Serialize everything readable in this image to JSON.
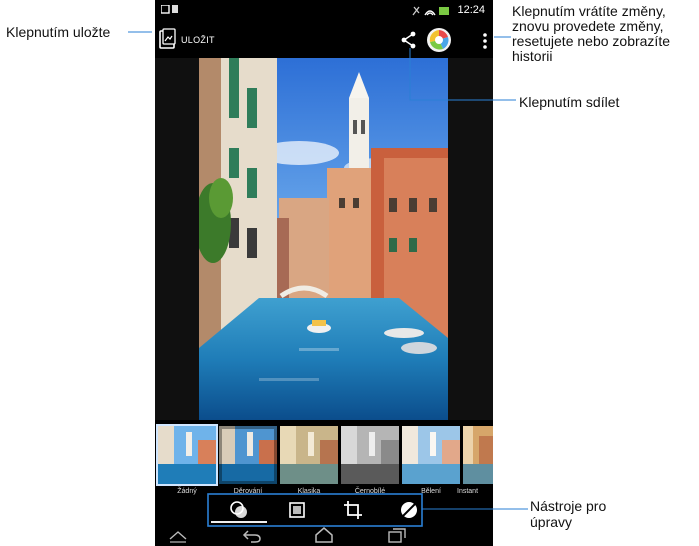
{
  "callouts": {
    "save": "Klepnutím uložte",
    "more_lines": [
      "Klepnutím vrátíte změny,",
      "znovu provedete změny,",
      "resetujete nebo zobrazíte",
      "historii"
    ],
    "share": "Klepnutím sdílet",
    "tools_lines": [
      "Nástroje pro",
      "úpravy"
    ]
  },
  "status_bar": {
    "time": "12:24"
  },
  "action_bar": {
    "save_label": "ULOŽIT",
    "icons": [
      "share-icon",
      "edit-effects-icon",
      "more-vert-icon"
    ]
  },
  "filters": [
    {
      "label": "Žádný",
      "selected": true
    },
    {
      "label": "Děrování"
    },
    {
      "label": "Klasika"
    },
    {
      "label": "Černobílé"
    },
    {
      "label": "Bělení"
    },
    {
      "label": "Instant"
    }
  ],
  "tools": [
    "filter-tool-icon",
    "frame-tool-icon",
    "crop-tool-icon",
    "adjust-tool-icon"
  ],
  "navigation": [
    "back-icon",
    "home-icon",
    "recent-apps-icon"
  ],
  "colors": {
    "leader_line": "#2a7fd4",
    "highlight_box": "#2a7fd4",
    "device_bg": "#000000"
  }
}
